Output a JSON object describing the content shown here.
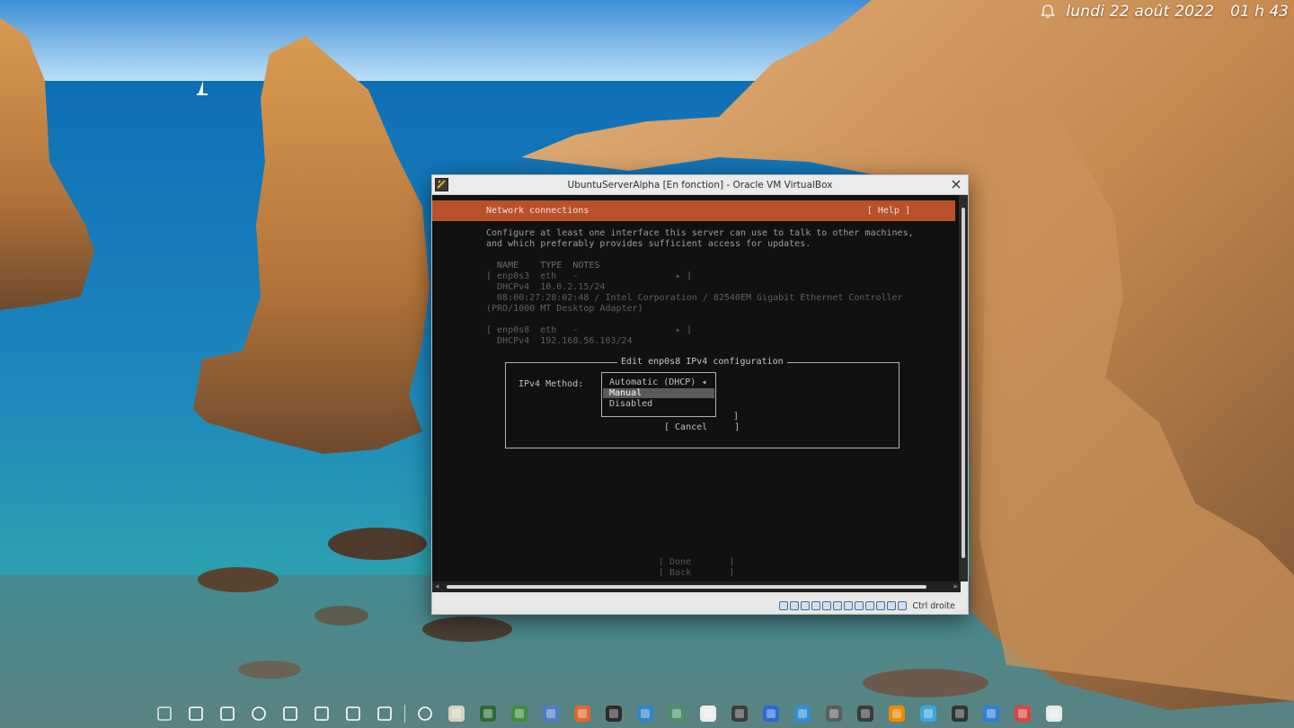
{
  "topbar": {
    "date": "lundi 22 août 2022",
    "time": "01 h 43"
  },
  "vbox": {
    "title": "UbuntuServerAlpha [En fonction] - Oracle VM VirtualBox",
    "host_key": "Ctrl droite"
  },
  "tui": {
    "header_title": "Network connections",
    "help": "[ Help ]",
    "intro_line1": "Configure at least one interface this server can use to talk to other machines,",
    "intro_line2": "and which preferably provides sufficient access for updates.",
    "columns": "  NAME    TYPE  NOTES",
    "iface1_row": "[ enp0s3  eth   -                  ▸ ]",
    "iface1_dhcp": "  DHCPv4  10.0.2.15/24",
    "iface1_mac": "  08:00:27:28:02:48 / Intel Corporation / 82540EM Gigabit Ethernet Controller",
    "iface1_adapter": "(PRO/1000 MT Desktop Adapter)",
    "iface2_row": "[ enp0s8  eth   -                  ▸ ]",
    "iface2_dhcp": "  DHCPv4  192.168.56.103/24",
    "dialog_title": "Edit enp0s8 IPv4 configuration",
    "ipv4_method_label": "IPv4 Method:",
    "options": [
      "Automatic (DHCP) ◂",
      "Manual",
      "Disabled"
    ],
    "save_bracket": "]",
    "cancel": "[ Cancel     ]",
    "done": "[ Done       ]",
    "back": "[ Back       ]"
  },
  "dock": {
    "icons": [
      "network-manager-icon",
      "app-grid-icon",
      "window-icon",
      "night-light-icon",
      "wifi-icon",
      "volume-icon",
      "eject-icon",
      "color-picker-icon",
      "circle-icon",
      "notes-icon",
      "globe-app-icon",
      "keepass-icon",
      "virtualbox-icon",
      "ubuntu-installer-icon",
      "terminal-icon",
      "files-icon",
      "system-monitor-icon",
      "font-viewer-icon",
      "calculator-icon",
      "ai-app-icon",
      "writer-icon",
      "gimp-icon",
      "inkscape-icon",
      "vlc-icon",
      "mail-icon",
      "console-icon",
      "thunderbird-icon",
      "archive-icon",
      "chrome-icon"
    ]
  }
}
